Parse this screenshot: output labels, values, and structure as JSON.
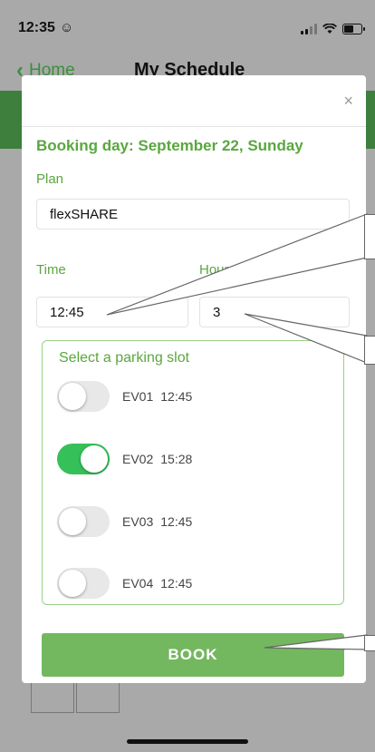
{
  "status_bar": {
    "time": "12:35",
    "face_icon": "smiley-icon",
    "signal_icon": "cellular-signal-icon",
    "wifi_icon": "wifi-icon",
    "battery_icon": "battery-icon"
  },
  "nav": {
    "back_label": "Home",
    "title": "My Schedule",
    "back_icon": "chevron-left-icon"
  },
  "modal": {
    "close_icon": "close-icon",
    "close_glyph": "×",
    "booking_day": "Booking day: September 22, Sunday",
    "plan_label": "Plan",
    "plan_value": "flexSHARE",
    "time_label": "Time",
    "time_value": "12:45",
    "hours_label": "Hours",
    "hours_value": "3",
    "slot_section_title": "Select a parking slot",
    "slots": [
      {
        "id": "EV01",
        "time": "12:45",
        "selected": false
      },
      {
        "id": "EV02",
        "time": "15:28",
        "selected": true
      },
      {
        "id": "EV03",
        "time": "12:45",
        "selected": false
      },
      {
        "id": "EV04",
        "time": "12:45",
        "selected": false
      }
    ],
    "book_label": "BOOK"
  },
  "colors": {
    "accent_green": "#5aa73f",
    "toggle_on": "#35c05a",
    "book_button": "#73b85f",
    "header_band": "#3e7f3e"
  }
}
